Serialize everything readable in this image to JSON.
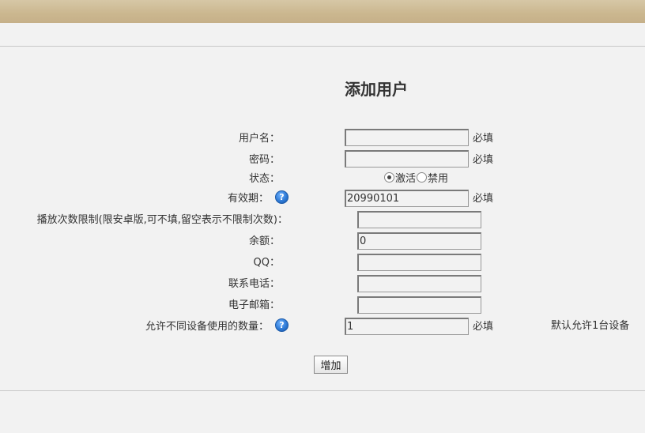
{
  "page": {
    "title": "添加用户"
  },
  "form": {
    "username": {
      "label": "用户名：",
      "value": "",
      "required": "必填"
    },
    "password": {
      "label": "密码：",
      "value": "",
      "required": "必填"
    },
    "status": {
      "label": "状态：",
      "options": [
        "激活",
        "禁用"
      ],
      "selected": "激活"
    },
    "expiry": {
      "label": "有效期：",
      "value": "20990101",
      "required": "必填"
    },
    "play_limit": {
      "label": "播放次数限制(限安卓版,可不填,留空表示不限制次数)：",
      "value": ""
    },
    "balance": {
      "label": "余额：",
      "value": "0"
    },
    "qq": {
      "label": "QQ：",
      "value": ""
    },
    "phone": {
      "label": "联系电话：",
      "value": ""
    },
    "email": {
      "label": "电子邮箱：",
      "value": ""
    },
    "device_count": {
      "label": "允许不同设备使用的数量：",
      "value": "1",
      "required": "必填",
      "note": "默认允许1台设备"
    },
    "help_icon": "?",
    "submit_label": "增加"
  },
  "colors": {
    "topbar": "#cbb78f",
    "background": "#f2f2f2",
    "help_icon": "#2a76d2"
  }
}
